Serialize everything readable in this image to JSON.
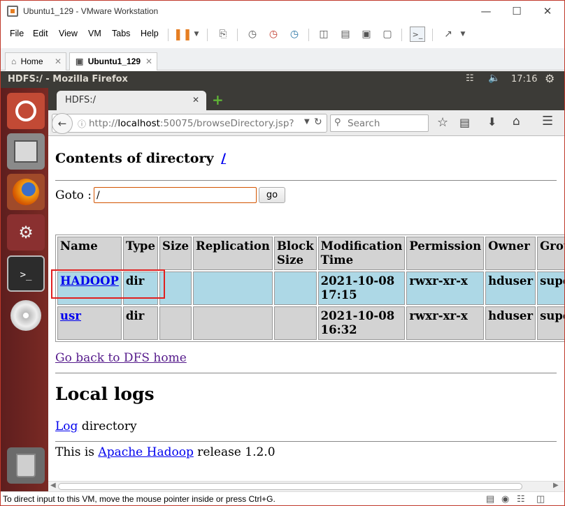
{
  "vmware": {
    "title": "Ubuntu1_129 - VMware Workstation",
    "menu": [
      "File",
      "Edit",
      "View",
      "VM",
      "Tabs",
      "Help"
    ],
    "tabs": [
      {
        "label": "Home",
        "icon": "home-icon"
      },
      {
        "label": "Ubuntu1_129",
        "icon": "vm-icon"
      }
    ],
    "status": "To direct input to this VM, move the mouse pointer inside or press Ctrl+G."
  },
  "ubuntu": {
    "window_title": "HDFS:/ - Mozilla Firefox",
    "clock": "17:16",
    "launcher": [
      "ubuntu-logo-icon",
      "files-icon",
      "firefox-icon",
      "settings-icon",
      "terminal-icon",
      "dvd-icon",
      "trash-icon"
    ]
  },
  "firefox": {
    "tab_title": "HDFS:/",
    "url_prefix": "http://",
    "url_host": "localhost",
    "url_rest": ":50075/browseDirectory.jsp?",
    "search_placeholder": "Search"
  },
  "page": {
    "heading": "Contents of directory",
    "heading_link": "/",
    "goto_label": "Goto :",
    "goto_value": "/",
    "goto_button": "go",
    "columns": [
      "Name",
      "Type",
      "Size",
      "Replication",
      "Block Size",
      "Modification Time",
      "Permission",
      "Owner",
      "Group"
    ],
    "rows": [
      {
        "name": "HADOOP",
        "type": "dir",
        "size": "",
        "replication": "",
        "block_size": "",
        "mod_time": "2021-10-08 17:15",
        "permission": "rwxr-xr-x",
        "owner": "hduser",
        "group": "supergr"
      },
      {
        "name": "usr",
        "type": "dir",
        "size": "",
        "replication": "",
        "block_size": "",
        "mod_time": "2021-10-08 16:32",
        "permission": "rwxr-xr-x",
        "owner": "hduser",
        "group": "supergr"
      }
    ],
    "back_link": "Go back to DFS home",
    "local_logs_heading": "Local logs",
    "log_link": "Log",
    "log_suffix": " directory",
    "footer_prefix": "This is ",
    "footer_link": "Apache Hadoop",
    "footer_suffix": " release 1.2.0"
  },
  "colors": {
    "highlight_box": "#e02020",
    "row_selected": "#add8e6",
    "row_default": "#d3d3d3",
    "launcher": "#6e2622"
  }
}
